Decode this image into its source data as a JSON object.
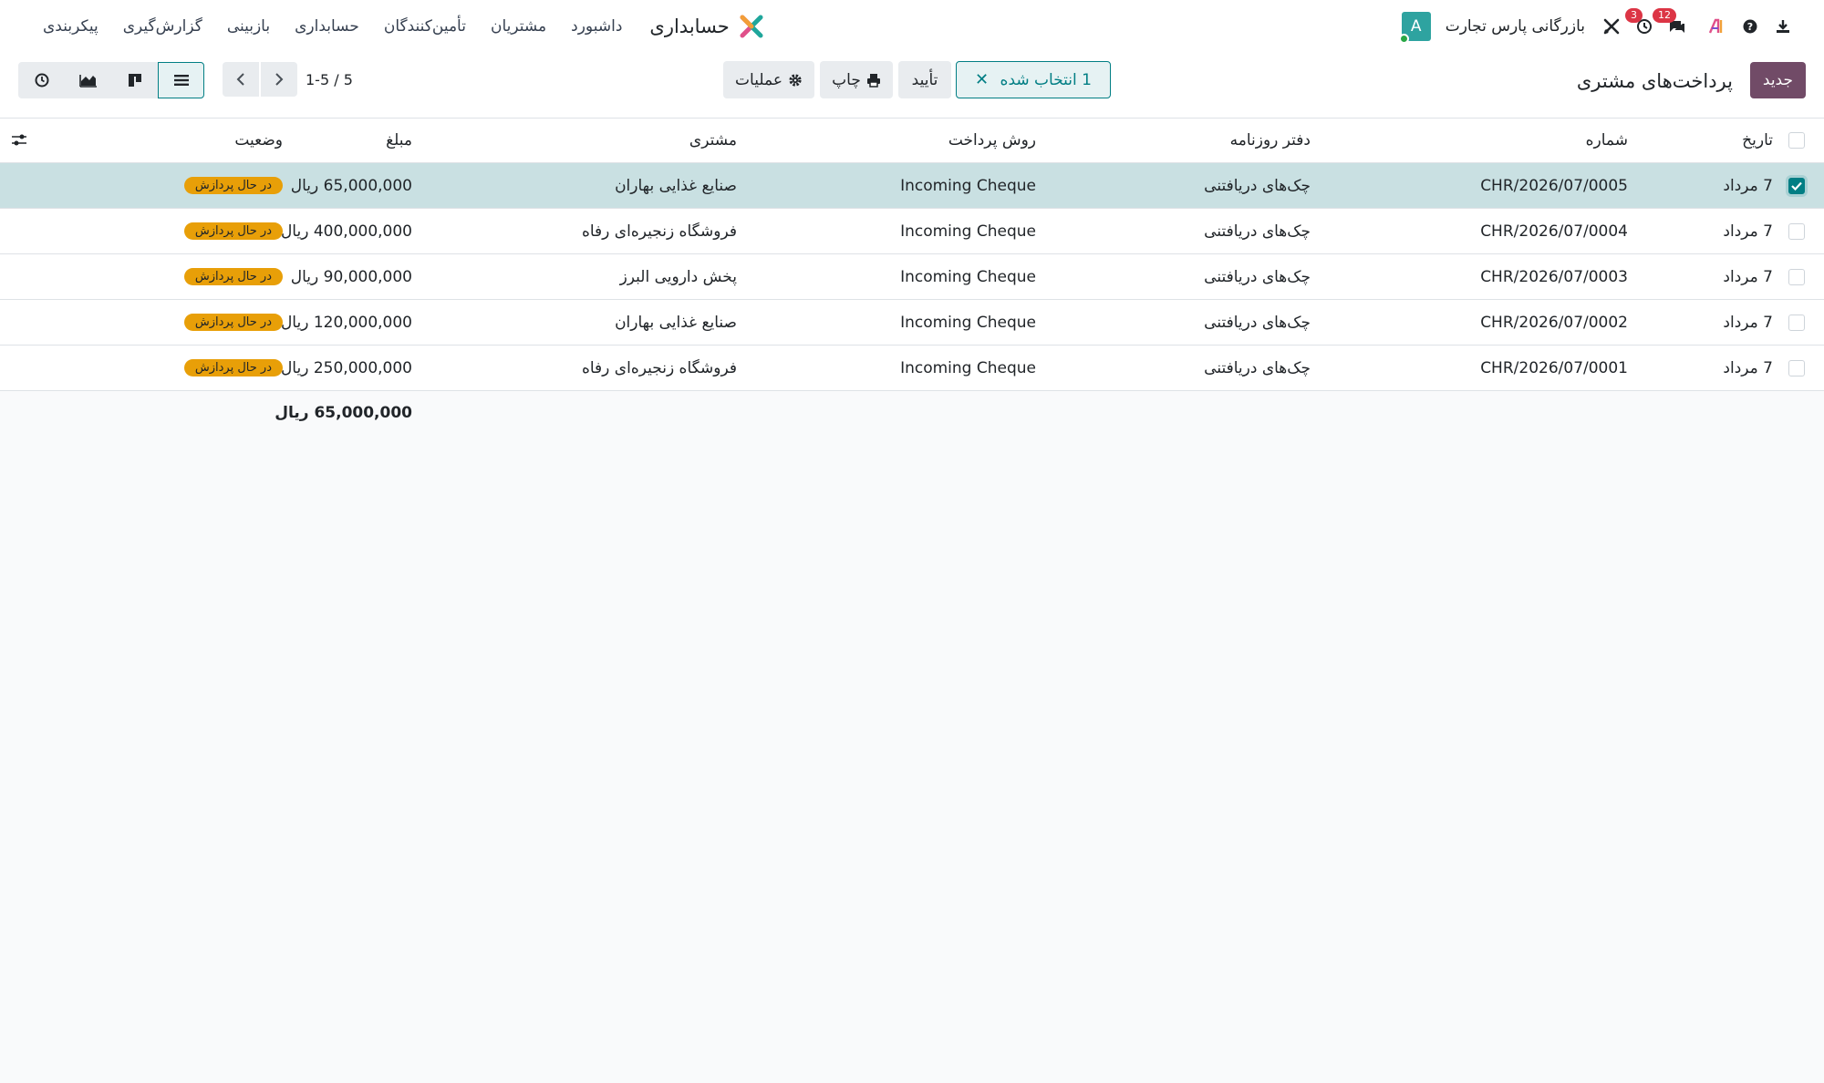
{
  "app": {
    "title": "حسابداری",
    "menu": [
      "داشبورد",
      "مشتریان",
      "تأمین‌کنندگان",
      "حسابداری",
      "بازبینی",
      "گزارش‌گیری",
      "پیکربندی"
    ]
  },
  "systray": {
    "company": "بازرگانی پارس تجارت",
    "avatar_letter": "A",
    "messages_count": "12",
    "activities_count": "3",
    "icons": [
      "download-icon",
      "help-icon",
      "ai-icon",
      "messages-icon",
      "clock-icon",
      "tools-icon"
    ]
  },
  "control_panel": {
    "new_label": "جدید",
    "page_title": "پرداخت‌های مشتری",
    "selected_label": "1 انتخاب شده",
    "confirm_label": "تأیید",
    "print_label": "چاپ",
    "actions_label": "عملیات",
    "pager": "1-5 / 5",
    "views": [
      "list-view-icon",
      "kanban-view-icon",
      "graph-view-icon",
      "activity-view-icon"
    ],
    "active_view": "list"
  },
  "table": {
    "columns": {
      "date": "تاریخ",
      "number": "شماره",
      "journal": "دفتر روزنامه",
      "method": "روش پرداخت",
      "customer": "مشتری",
      "amount": "مبلغ",
      "status": "وضعیت"
    },
    "rows": [
      {
        "selected": true,
        "date": "7 مرداد",
        "number": "CHR/2026/07/0005",
        "journal": "چک‌های دریافتنی",
        "method": "Incoming Cheque",
        "customer": "صنایع غذایی بهاران",
        "amount": "65,000,000 ریال",
        "status": "در حال پردازش"
      },
      {
        "selected": false,
        "date": "7 مرداد",
        "number": "CHR/2026/07/0004",
        "journal": "چک‌های دریافتنی",
        "method": "Incoming Cheque",
        "customer": "فروشگاه زنجیره‌ای رفاه",
        "amount": "400,000,000 ریال",
        "status": "در حال پردازش"
      },
      {
        "selected": false,
        "date": "7 مرداد",
        "number": "CHR/2026/07/0003",
        "journal": "چک‌های دریافتنی",
        "method": "Incoming Cheque",
        "customer": "پخش دارویی البرز",
        "amount": "90,000,000 ریال",
        "status": "در حال پردازش"
      },
      {
        "selected": false,
        "date": "7 مرداد",
        "number": "CHR/2026/07/0002",
        "journal": "چک‌های دریافتنی",
        "method": "Incoming Cheque",
        "customer": "صنایع غذایی بهاران",
        "amount": "120,000,000 ریال",
        "status": "در حال پردازش"
      },
      {
        "selected": false,
        "date": "7 مرداد",
        "number": "CHR/2026/07/0001",
        "journal": "چک‌های دریافتنی",
        "method": "Incoming Cheque",
        "customer": "فروشگاه زنجیره‌ای رفاه",
        "amount": "250,000,000 ریال",
        "status": "در حال پردازش"
      }
    ],
    "total": "65,000,000 ریال"
  },
  "colors": {
    "brand": "#714b67",
    "accent": "#017e84",
    "status_processing": "#e89f08",
    "badge": "#dc3545"
  }
}
